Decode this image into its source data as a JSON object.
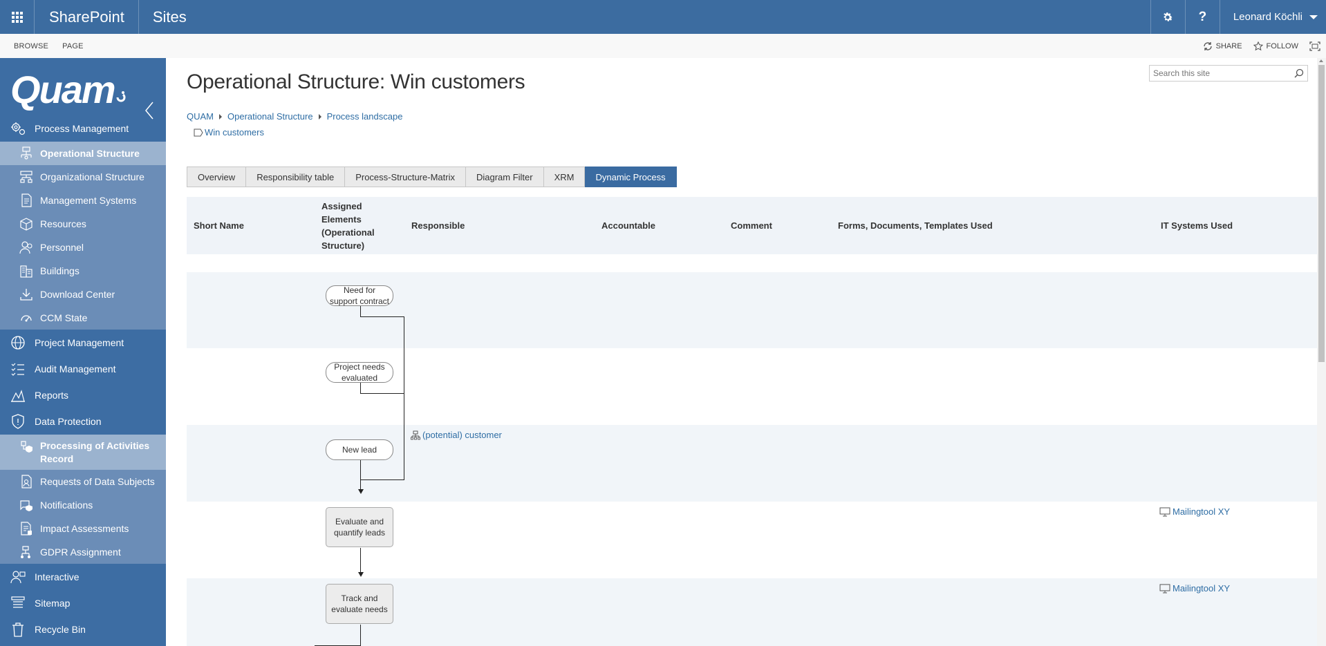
{
  "suitebar": {
    "brand": "SharePoint",
    "section": "Sites",
    "user": "Leonard Köchli",
    "help_label": "?"
  },
  "ribbon": {
    "tabs": [
      "BROWSE",
      "PAGE"
    ],
    "share_label": "SHARE",
    "follow_label": "FOLLOW"
  },
  "leftnav": {
    "logo_text": "Quam",
    "groups": [
      {
        "label": "Process Management",
        "icon": "gears-icon"
      },
      {
        "label": "Project Management",
        "icon": "globe-icon"
      },
      {
        "label": "Audit Management",
        "icon": "checklist-icon"
      },
      {
        "label": "Reports",
        "icon": "chart-icon"
      },
      {
        "label": "Data Protection",
        "icon": "shield-icon"
      },
      {
        "label": "Interactive",
        "icon": "people-icon"
      },
      {
        "label": "Sitemap",
        "icon": "sitemap-icon"
      },
      {
        "label": "Recycle Bin",
        "icon": "trash-icon"
      }
    ],
    "process_items": [
      {
        "label": "Operational Structure",
        "icon": "flow-icon"
      },
      {
        "label": "Organizational Structure",
        "icon": "org-icon"
      },
      {
        "label": "Management Systems",
        "icon": "doc-icon"
      },
      {
        "label": "Resources",
        "icon": "box-icon"
      },
      {
        "label": "Personnel",
        "icon": "person-icon"
      },
      {
        "label": "Buildings",
        "icon": "building-icon"
      },
      {
        "label": "Download Center",
        "icon": "download-icon"
      },
      {
        "label": "CCM State",
        "icon": "gauge-icon"
      }
    ],
    "data_protection_items": [
      {
        "label": "Processing of Activities Record",
        "icon": "record-icon"
      },
      {
        "label": "Requests of Data Subjects",
        "icon": "request-icon"
      },
      {
        "label": "Notifications",
        "icon": "notification-icon"
      },
      {
        "label": "Impact Assessments",
        "icon": "assessment-icon"
      },
      {
        "label": "GDPR Assignment",
        "icon": "assignment-icon"
      }
    ]
  },
  "page": {
    "title": "Operational Structure: Win customers",
    "search_placeholder": "Search this site",
    "breadcrumb": [
      "QUAM",
      "Operational Structure",
      "Process landscape"
    ],
    "subcrumb": "Win customers",
    "tabs": [
      "Overview",
      "Responsibility table",
      "Process-Structure-Matrix",
      "Diagram Filter",
      "XRM",
      "Dynamic Process"
    ],
    "active_tab": "Dynamic Process"
  },
  "table": {
    "headers": {
      "short_name": "Short Name",
      "assigned": "Assigned Elements (Operational Structure)",
      "assigned_lines": [
        "Assigned",
        "Elements",
        "(Operational",
        "Structure)"
      ],
      "responsible": "Responsible",
      "accountable": "Accountable",
      "comment": "Comment",
      "forms": "Forms, Documents, Templates Used",
      "it_systems": "IT Systems Used"
    },
    "nodes": [
      {
        "label_lines": [
          "Need for",
          "support contract"
        ],
        "type": "event"
      },
      {
        "label_lines": [
          "Project needs",
          "evaluated"
        ],
        "type": "event"
      },
      {
        "label_lines": [
          "New lead"
        ],
        "type": "event"
      },
      {
        "label_lines": [
          "Evaluate and",
          "quantify leads"
        ],
        "type": "task"
      },
      {
        "label_lines": [
          "Track and",
          "evaluate needs"
        ],
        "type": "task"
      }
    ],
    "responsible_link": "(potential) customer",
    "it_links": [
      "Mailingtool XY",
      "Mailingtool XY"
    ]
  }
}
